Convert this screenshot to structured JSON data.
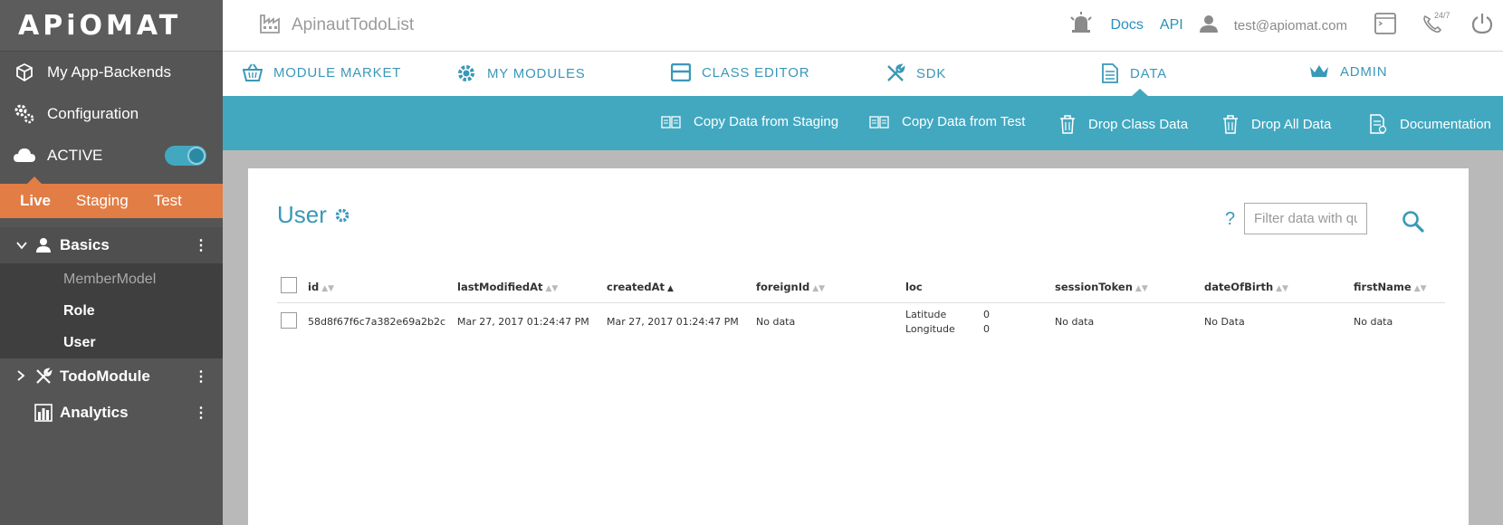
{
  "logo": "APiOMAT",
  "sidebar": {
    "items": [
      {
        "label": "My App-Backends",
        "icon": "cube-icon"
      },
      {
        "label": "Configuration",
        "icon": "gears-icon"
      },
      {
        "label": "ACTIVE",
        "icon": "cloud-icon",
        "toggle": true
      }
    ],
    "env_tabs": [
      "Live",
      "Staging",
      "Test"
    ],
    "active_env": "Live",
    "tree": {
      "basics": {
        "label": "Basics",
        "children": [
          "MemberModel",
          "Role",
          "User"
        ]
      },
      "todo": {
        "label": "TodoModule"
      },
      "analytics": {
        "label": "Analytics"
      }
    }
  },
  "topbar": {
    "app_name": "ApinautTodoList",
    "docs": "Docs",
    "api": "API",
    "email": "test@apiomat.com",
    "support": "24/7"
  },
  "modnav": [
    {
      "label": "MODULE MARKET",
      "icon": "basket-icon"
    },
    {
      "label": "MY MODULES",
      "icon": "gear-icon"
    },
    {
      "label": "CLASS EDITOR",
      "icon": "class-icon"
    },
    {
      "label": "SDK",
      "icon": "tools-icon"
    },
    {
      "label": "DATA",
      "icon": "document-icon"
    },
    {
      "label": "ADMIN",
      "icon": "crown-icon"
    }
  ],
  "actions": [
    {
      "label": "Copy Data from Staging",
      "icon": "copy-icon"
    },
    {
      "label": "Copy Data from Test",
      "icon": "copy-icon"
    },
    {
      "label": "Drop Class Data",
      "icon": "trash-icon"
    },
    {
      "label": "Drop All Data",
      "icon": "trash-icon"
    },
    {
      "label": "Documentation",
      "icon": "doc-icon"
    }
  ],
  "content": {
    "title": "User",
    "help": "?",
    "filter_placeholder": "Filter data with query",
    "columns": [
      "id",
      "lastModifiedAt",
      "createdAt",
      "foreignId",
      "loc",
      "sessionToken",
      "dateOfBirth",
      "firstName"
    ],
    "sorted_column": "createdAt",
    "rows": [
      {
        "id": "58d8f67f6c7a382e69a2b2c",
        "lastModifiedAt": "Mar 27, 2017 01:24:47 PM",
        "createdAt": "Mar 27, 2017 01:24:47 PM",
        "foreignId": "No data",
        "loc_latitude_label": "Latitude",
        "loc_latitude": "0",
        "loc_longitude_label": "Longitude",
        "loc_longitude": "0",
        "sessionToken": "No data",
        "dateOfBirth": "No Data",
        "firstName": "No data"
      }
    ]
  }
}
